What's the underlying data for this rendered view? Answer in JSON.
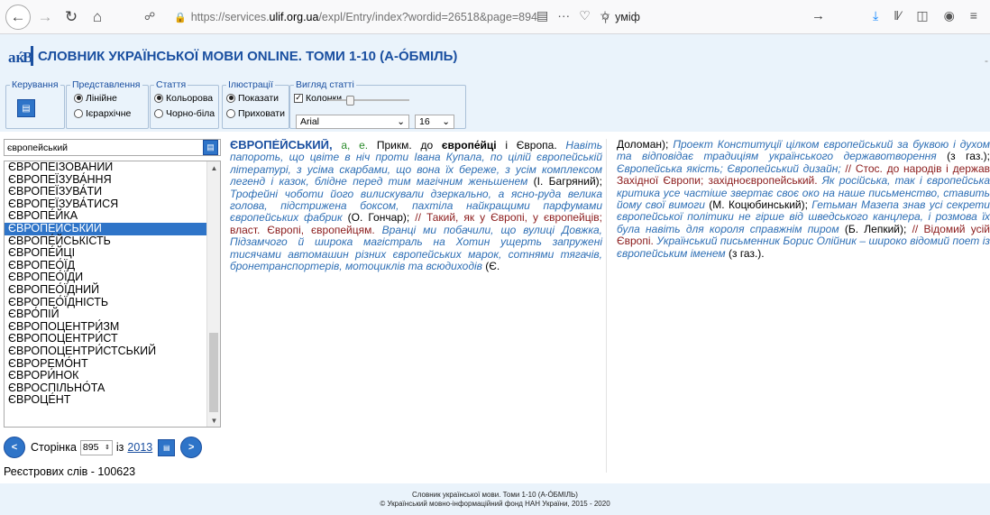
{
  "browser": {
    "url_prefix": "https://services.",
    "url_host": "ulif.org.ua",
    "url_path": "/expl/Entry/index?wordid=26518&page=894",
    "search_query": "уміф",
    "more_menu": "···"
  },
  "header": {
    "title": "СЛОВНИК УКРАЇНСЬКОЇ МОВИ ONLINE. ТОМИ 1-10 (А-ÓБМІЛЬ)",
    "dash": "-"
  },
  "controls": {
    "control_legend": "Керування",
    "view_legend": "Представлення",
    "view_linear": "Лінійне",
    "view_hierarchical": "Ієрархічне",
    "article_legend": "Стаття",
    "article_color": "Кольорова",
    "article_bw": "Чорно-біла",
    "illus_legend": "Ілюстрації",
    "illus_show": "Показати",
    "illus_hide": "Приховати",
    "appearance_legend": "Вигляд статті",
    "columns_label": "Колонки",
    "columns_slider_value": 0.25,
    "font": "Arial",
    "font_size": "16"
  },
  "search": {
    "value": "європейський"
  },
  "wordlist": [
    "ЄВРОПЕІЗОВАНИЙ",
    "ЄВРОПЕЇЗУВА́ННЯ",
    "ЄВРОПЕЇЗУВА́ТИ",
    "ЄВРОПЕЇЗУВА́ТИСЯ",
    "ЄВРОПЕ́ЙКА",
    "ЄВРОПЕ́ЙСЬКИЙ",
    "ЄВРОПЕ́ЙСЬКІСТЬ",
    "ЄВРОПЕ́ЙЦІ",
    "ЄВРОПЕО́ЇД",
    "ЄВРОПЕО́ЇДИ",
    "ЄВРОПЕО́ЇДНИЙ",
    "ЄВРОПЕО́ЇДНІСТЬ",
    "ЄВРО́ПІЙ",
    "ЄВРОПОЦЕНТРИ́ЗМ",
    "ЄВРОПОЦЕНТРИ́СТ",
    "ЄВРОПОЦЕНТРИ́СТСЬКИЙ",
    "ЄВРОРЕМО́НТ",
    "ЄВРОРИ́НОК",
    "ЄВРОСПІЛЬНО́ТА",
    "ЄВРОЦЕ́НТ"
  ],
  "selected_index": 5,
  "pager": {
    "prev": "<",
    "label": "Сторінка",
    "current": "895",
    "of": "із",
    "total": "2013",
    "next": ">"
  },
  "registry": "Реєстрових слів - 100623",
  "article": {
    "col1": [
      {
        "t": "hw",
        "v": "ЄВРОПЕ́ЙСЬКИЙ,"
      },
      {
        "t": "gram",
        "v": " а, е."
      },
      {
        "t": "plain",
        "v": " Прикм. до "
      },
      {
        "t": "crossref",
        "v": "європе́йці"
      },
      {
        "t": "plain",
        "v": " і Європа. "
      },
      {
        "t": "cite",
        "v": "Навіть папороть, що цвіте в ніч проти Івана Купала, по цілій європейській літературі, з усіма скарбами, що вона їх береже, з усім комплексом легенд і казок, блідне перед тим магічним женьшенем"
      },
      {
        "t": "plain",
        "v": " (І. Багряний); "
      },
      {
        "t": "cite",
        "v": "Трофейні чоботи його вилискували дзеркально, а ясно-руда велика голова, підстрижена боксом, пахтіла найкращими парфумами європейських фабрик"
      },
      {
        "t": "plain",
        "v": " (О. Гончар); "
      },
      {
        "t": "meaning",
        "v": "// Такий, як у Європі, у європейців; власт. Європі, європейцям."
      },
      {
        "t": "cite",
        "v": " Вранці ми побачили, що вулиці Довжка, Підзамчого й широка магістраль на Хотин ущерть запружені тисячами автомашин різних європейських марок, сотнями тягачів, бронетранспортерів, мотоциклів та всюдиходів"
      },
      {
        "t": "plain",
        "v": " (Є."
      }
    ],
    "col2": [
      {
        "t": "plain",
        "v": "Доломан); "
      },
      {
        "t": "cite",
        "v": "Проект Конституції цілком європейський за букв​ою і духом та відповідає традиціям українського державотворення"
      },
      {
        "t": "plain",
        "v": " (з газ.); "
      },
      {
        "t": "cite",
        "v": "Європейська якість; Європейський дизайн;"
      },
      {
        "t": "meaning",
        "v": " // Стос. до народів і держав Західної Європи; західноєвропейський."
      },
      {
        "t": "cite",
        "v": " Як російська, так і європейська критика усе частіше звертає своє око на наше письменство, ставить йому свої вимоги"
      },
      {
        "t": "plain",
        "v": " (М. Коцюбинський); "
      },
      {
        "t": "cite",
        "v": "Гетьман Мазепа знав усі секрети європейської політики не гірше від шведського канцлера, і розмова їх була навіть для короля справжнім пиром"
      },
      {
        "t": "plain",
        "v": " (Б. Лепкий); "
      },
      {
        "t": "meaning",
        "v": "// Відомий усій Європі."
      },
      {
        "t": "cite",
        "v": " Український письменник Борис Олійник – широко відомий поет із європейським іменем"
      },
      {
        "t": "plain",
        "v": " (з газ.)."
      }
    ]
  },
  "footer": {
    "line1": "Словник української мови. Томи 1-10 (А-ÓБМІЛЬ)",
    "line2": "© Український мовно-інформаційний фонд НАН України, 2015 - 2020"
  },
  "colors": {
    "accent": "#2e74c8",
    "headword": "#1a4fa0",
    "citation": "#2e6fb5",
    "meaning": "#8b1b1b",
    "grammar": "#2a8a2a",
    "panel_bg": "#eaf3fb"
  },
  "icons": [
    "back-icon",
    "forward-icon",
    "reload-icon",
    "home-icon",
    "shield-icon",
    "lock-icon",
    "reader-icon",
    "more-icon",
    "pocket-icon",
    "star-icon",
    "search-icon",
    "arrow-right-icon",
    "download-icon",
    "library-icon",
    "sidebar-icon",
    "account-icon",
    "menu-icon",
    "logo-icon",
    "scroll-icon",
    "book-icon"
  ]
}
